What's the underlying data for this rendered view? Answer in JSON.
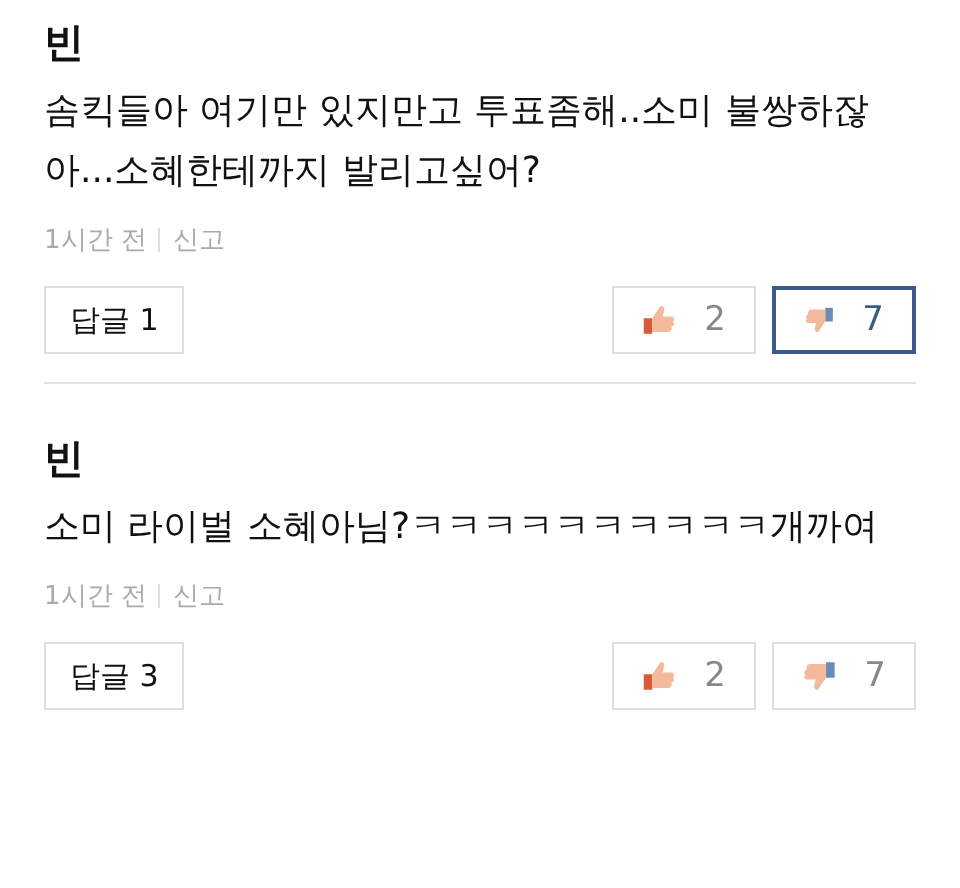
{
  "comments": [
    {
      "author": "빈",
      "text": "솜킥들아 여기만 있지만고 투표좀해..소미 불쌍하잖아...소혜한테까지 발리고싶어?",
      "time": "1시간 전",
      "report": "신고",
      "reply_button": "답글 1",
      "likes": "2",
      "dislikes": "7",
      "liked": false,
      "disliked": true
    },
    {
      "author": "빈",
      "text": "소미 라이벌 소혜아님?ㅋㅋㅋㅋㅋㅋㅋㅋㅋㅋ개까여",
      "time": "1시간 전",
      "report": "신고",
      "reply_button": "답글 3",
      "likes": "2",
      "dislikes": "7",
      "liked": false,
      "disliked": false
    }
  ]
}
